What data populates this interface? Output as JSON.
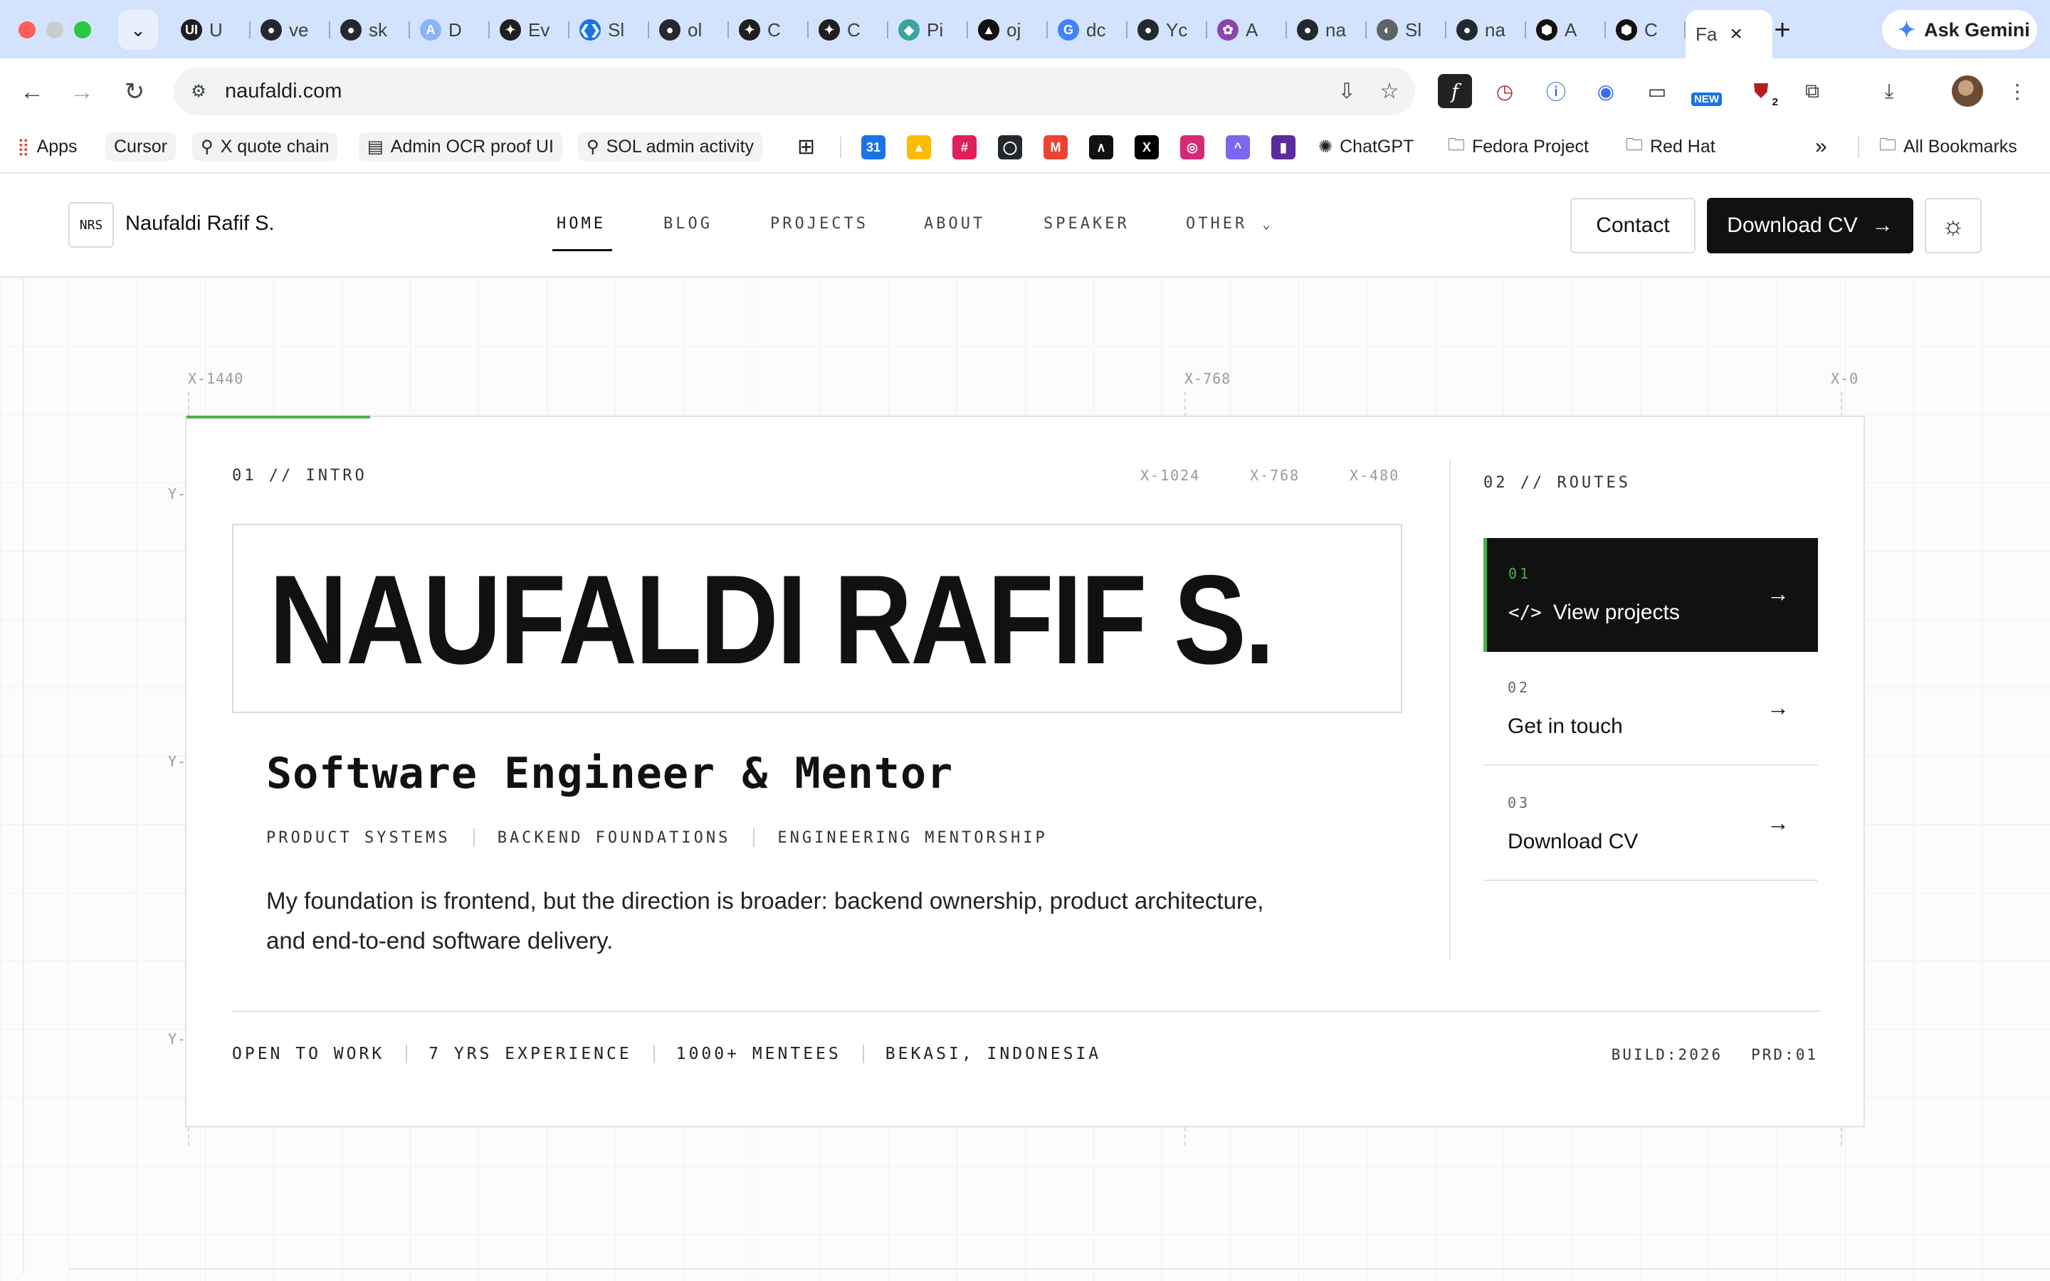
{
  "browser": {
    "tabs": [
      {
        "label": "U",
        "fav": "UI",
        "color": "#1f1f1f"
      },
      {
        "label": "ve",
        "fav": "gh",
        "color": "#24292f"
      },
      {
        "label": "sk",
        "fav": "gh",
        "color": "#24292f"
      },
      {
        "label": "D",
        "fav": "A",
        "color": "#8ab4f8"
      },
      {
        "label": "Ev",
        "fav": "✦",
        "color": "#1f1f1f"
      },
      {
        "label": "Sl",
        "fav": "❮❯",
        "color": "#1a73e8"
      },
      {
        "label": "ol",
        "fav": "gh",
        "color": "#24292f"
      },
      {
        "label": "C",
        "fav": "✦",
        "color": "#1f1f1f"
      },
      {
        "label": "C",
        "fav": "✦",
        "color": "#1f1f1f"
      },
      {
        "label": "Pi",
        "fav": "◆",
        "color": "#3aa59b"
      },
      {
        "label": "oj",
        "fav": "▲",
        "color": "#111"
      },
      {
        "label": "dc",
        "fav": "G",
        "color": "#4285f4"
      },
      {
        "label": "Yc",
        "fav": "gh",
        "color": "#24292f"
      },
      {
        "label": "A",
        "fav": "✿",
        "color": "#8e44ad"
      },
      {
        "label": "na",
        "fav": "gh",
        "color": "#24292f"
      },
      {
        "label": "Sl",
        "fav": "◐",
        "color": "#5f6368"
      },
      {
        "label": "na",
        "fav": "gh",
        "color": "#24292f"
      },
      {
        "label": "A",
        "fav": "⬢",
        "color": "#111"
      },
      {
        "label": "C",
        "fav": "⬢",
        "color": "#111"
      }
    ],
    "active_tab": {
      "label": "Fa"
    },
    "ask_gemini": "Ask Gemini",
    "url": "naufaldi.com",
    "icons": {
      "back": "arrow-left-icon",
      "forward": "arrow-right-icon",
      "reload": "reload-icon"
    },
    "bookmarks": {
      "apps": "Apps",
      "cursor": "Cursor",
      "x_quote": "X quote chain",
      "admin_ocr": "Admin OCR proof UI",
      "sol_admin": "SOL admin activity",
      "chatgpt": "ChatGPT",
      "fedora": "Fedora Project",
      "redhat": "Red Hat",
      "all": "All Bookmarks"
    },
    "badge_new": "NEW",
    "badge_count": "2"
  },
  "site": {
    "logo_mark": "NRS",
    "logo_name": "Naufaldi Rafif S.",
    "nav": {
      "home": "HOME",
      "blog": "BLOG",
      "projects": "PROJECTS",
      "about": "ABOUT",
      "speaker": "SPEAKER",
      "other": "OTHER"
    },
    "contact": "Contact",
    "download_cv": "Download CV"
  },
  "hero": {
    "coords": {
      "x1440": "X-1440",
      "x768_top": "X-768",
      "x0": "X-0",
      "x1024": "X-1024",
      "x768": "X-768",
      "x480": "X-480",
      "y_a": "Y-",
      "y_b": "Y-",
      "y_c": "Y-"
    },
    "intro_label": "01 // INTRO",
    "name": "NAUFALDI RAFIF S.",
    "role": "Software Engineer & Mentor",
    "tags": [
      "PRODUCT SYSTEMS",
      "BACKEND FOUNDATIONS",
      "ENGINEERING MENTORSHIP"
    ],
    "description": "My foundation is frontend, but the direction is broader: backend ownership, product architecture, and end-to-end software delivery.",
    "routes_label": "02 // ROUTES",
    "routes": [
      {
        "num": "01",
        "label": "View projects"
      },
      {
        "num": "02",
        "label": "Get in touch"
      },
      {
        "num": "03",
        "label": "Download CV"
      }
    ],
    "stats": [
      "OPEN TO WORK",
      "7 YRS EXPERIENCE",
      "1000+ MENTEES",
      "BEKASI, INDONESIA"
    ],
    "build": "BUILD:2026",
    "prd": "PRD:01"
  },
  "colors": {
    "accent": "#4caf50",
    "primary_button": "#111111",
    "chrome_tabstrip": "#d3e3fd"
  }
}
